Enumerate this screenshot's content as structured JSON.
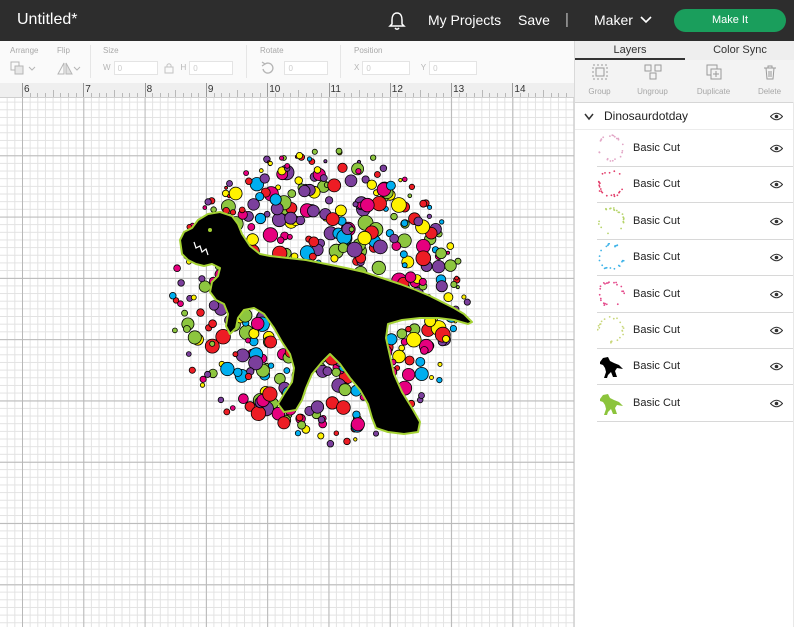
{
  "header": {
    "title": "Untitled*",
    "my_projects": "My Projects",
    "save": "Save",
    "separator": "|",
    "machine": "Maker",
    "make_it": "Make It"
  },
  "toolbar": {
    "arrange": "Arrange",
    "flip": "Flip",
    "size": "Size",
    "size_w": "W",
    "size_h": "H",
    "rotate": "Rotate",
    "position": "Position",
    "pos_x": "X",
    "pos_y": "Y",
    "zero": "0"
  },
  "ruler": {
    "numbers": [
      "6",
      "7",
      "8",
      "9",
      "10",
      "11",
      "12",
      "13",
      "14"
    ]
  },
  "panel": {
    "tab_layers": "Layers",
    "tab_color_sync": "Color Sync",
    "tools": {
      "group": "Group",
      "ungroup": "Ungroup",
      "duplicate": "Duplicate",
      "delete": "Delete"
    },
    "group_name": "Dinosaurdotday",
    "layers": [
      {
        "name": "Basic Cut",
        "color": "#e2a6c6"
      },
      {
        "name": "Basic Cut",
        "color": "#e23d6a"
      },
      {
        "name": "Basic Cut",
        "color": "#b6d46a"
      },
      {
        "name": "Basic Cut",
        "color": "#3fb3e8"
      },
      {
        "name": "Basic Cut",
        "color": "#e44a8b"
      },
      {
        "name": "Basic Cut",
        "color": "#c9d77b"
      },
      {
        "name": "Basic Cut",
        "color": "#000000"
      },
      {
        "name": "Basic Cut",
        "color": "#8cc43c"
      }
    ]
  },
  "design": {
    "dot_colors": [
      "#e6007e",
      "#fff200",
      "#00aeef",
      "#8dc63f",
      "#7b3f9c",
      "#ed1c24",
      "#000000"
    ],
    "outline_color": "#a4d233"
  },
  "colors": {
    "topbar": "#2d2d2d",
    "accent": "#1a9e5c"
  }
}
